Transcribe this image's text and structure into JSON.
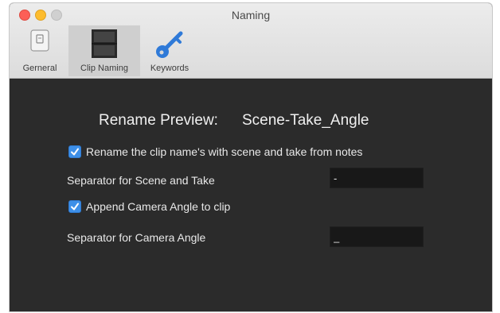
{
  "window": {
    "title": "Naming"
  },
  "toolbar": {
    "tabs": [
      {
        "label": "Gerneral",
        "icon": "general-device-icon",
        "selected": false
      },
      {
        "label": "Clip Naming",
        "icon": "clip-naming-icon",
        "selected": true
      },
      {
        "label": "Keywords",
        "icon": "key-icon",
        "selected": false
      }
    ]
  },
  "preview": {
    "label": "Rename Preview:",
    "value": "Scene-Take_Angle"
  },
  "options": {
    "rename_checkbox": {
      "label": "Rename the clip name's with scene and take from notes",
      "checked": true
    },
    "scene_take_separator": {
      "label": "Separator for Scene and Take",
      "value": "-"
    },
    "append_angle_checkbox": {
      "label": "Append Camera Angle to clip",
      "checked": true
    },
    "angle_separator": {
      "label": "Separator for Camera Angle",
      "value": "_"
    }
  },
  "colors": {
    "accent": "#3d8fe8",
    "panel_background": "#2b2b2b",
    "field_background": "#181818",
    "close": "#fc5f57",
    "minimize": "#fdbc2e",
    "zoom_inactive": "#d0d0d0"
  }
}
